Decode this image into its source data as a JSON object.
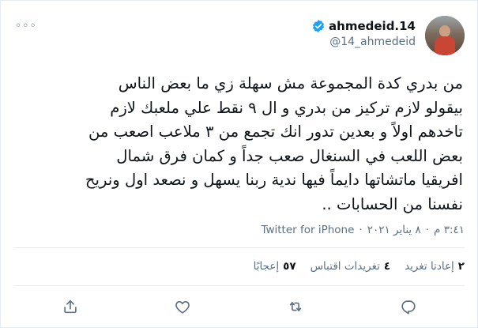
{
  "user": {
    "name": "ahmedeid.14",
    "handle": "@14_ahmedeid",
    "verified": true
  },
  "more_glyph": "◦◦◦",
  "tweet_lines": [
    "من بدري كدة المجموعة مش سهلة زي ما بعض الناس",
    "بيقولو لازم تركيز من بدري و ال ٩ نقط علي ملعبك لازم",
    "تاخدهم اولاً و بعدين تدور انك تجمع من ٣ ملاعب اصعب من",
    "بعض اللعب في السنغال صعب جداً و كمان فرق شمال",
    "افريقيا ماتشاتها دايماً فيها ندية ربنا يسهل و نصعد اول ونريح",
    "نفسنا من الحسابات .."
  ],
  "meta": {
    "time": "٣:٤١ م",
    "date": "٨ يناير ٢٠٢١",
    "separator": "·",
    "source": "Twitter for iPhone"
  },
  "stats": {
    "retweets_count": "٢",
    "retweets_label": "إعادتا تغريد",
    "quotes_count": "٤",
    "quotes_label": "تغريدات اقتباس",
    "likes_count": "٥٧",
    "likes_label": "إعجابًا"
  },
  "icons": [
    "reply-icon",
    "retweet-icon",
    "like-icon",
    "share-icon"
  ],
  "colors": {
    "verified": "#1da1f2",
    "secondary_text": "#5b7083",
    "divider": "#e6ecf0"
  }
}
